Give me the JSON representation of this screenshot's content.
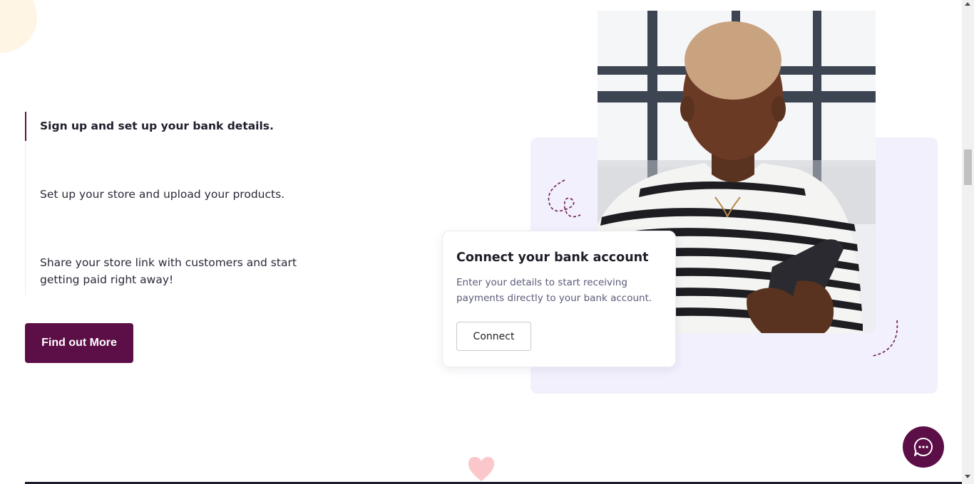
{
  "steps": [
    {
      "label": "Sign up and set up your bank details.",
      "active": true
    },
    {
      "label": "Set up your store and upload your products.",
      "active": false
    },
    {
      "label": "Share your store link with customers and start getting paid right away!",
      "active": false
    }
  ],
  "cta": {
    "label": "Find out More"
  },
  "card": {
    "title": "Connect your bank account",
    "text": "Enter your details to start receiving payments directly to your bank account.",
    "button_label": "Connect"
  },
  "photo": {
    "subject": "woman-using-phone"
  },
  "icons": {
    "chat": "chat-bubble-icon",
    "heart": "heart-icon"
  },
  "colors": {
    "brand": "#5c0e47",
    "lavender": "#f2f0fc",
    "heart": "#fbc7cb",
    "cream": "#fef5e4"
  }
}
